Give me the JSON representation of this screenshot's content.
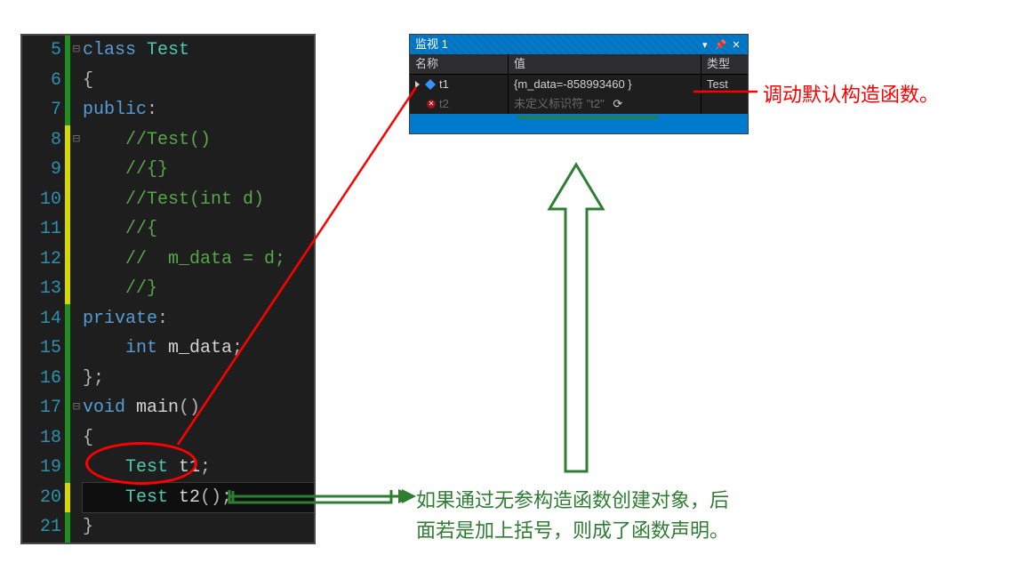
{
  "editor": {
    "lines": [
      {
        "num": 5,
        "marker": "green",
        "fold": "⊟",
        "tokens": [
          {
            "t": "kw",
            "v": "class"
          },
          {
            "t": "plain",
            "v": " "
          },
          {
            "t": "type",
            "v": "Test"
          }
        ]
      },
      {
        "num": 6,
        "marker": "green",
        "fold": " ",
        "tokens": [
          {
            "t": "punct",
            "v": "{"
          }
        ]
      },
      {
        "num": 7,
        "marker": "green",
        "fold": " ",
        "tokens": [
          {
            "t": "kw",
            "v": "public"
          },
          {
            "t": "punct",
            "v": ":"
          }
        ]
      },
      {
        "num": 8,
        "marker": "yellow",
        "fold": "⊟",
        "tokens": [
          {
            "t": "plain",
            "v": "    "
          },
          {
            "t": "comment",
            "v": "//Test()"
          }
        ]
      },
      {
        "num": 9,
        "marker": "yellow",
        "fold": " ",
        "tokens": [
          {
            "t": "plain",
            "v": "    "
          },
          {
            "t": "comment",
            "v": "//{}"
          }
        ]
      },
      {
        "num": 10,
        "marker": "yellow",
        "fold": " ",
        "tokens": [
          {
            "t": "plain",
            "v": "    "
          },
          {
            "t": "comment",
            "v": "//Test(int d)"
          }
        ]
      },
      {
        "num": 11,
        "marker": "yellow",
        "fold": " ",
        "tokens": [
          {
            "t": "plain",
            "v": "    "
          },
          {
            "t": "comment",
            "v": "//{"
          }
        ]
      },
      {
        "num": 12,
        "marker": "yellow",
        "fold": " ",
        "tokens": [
          {
            "t": "plain",
            "v": "    "
          },
          {
            "t": "comment",
            "v": "//  m_data = d;"
          }
        ]
      },
      {
        "num": 13,
        "marker": "yellow",
        "fold": " ",
        "tokens": [
          {
            "t": "plain",
            "v": "    "
          },
          {
            "t": "comment",
            "v": "//}"
          }
        ]
      },
      {
        "num": 14,
        "marker": "green",
        "fold": " ",
        "tokens": [
          {
            "t": "kw",
            "v": "private"
          },
          {
            "t": "punct",
            "v": ":"
          }
        ]
      },
      {
        "num": 15,
        "marker": "green",
        "fold": " ",
        "tokens": [
          {
            "t": "plain",
            "v": "    "
          },
          {
            "t": "kw",
            "v": "int"
          },
          {
            "t": "plain",
            "v": " m_data"
          },
          {
            "t": "punct",
            "v": ";"
          }
        ]
      },
      {
        "num": 16,
        "marker": "green",
        "fold": " ",
        "tokens": [
          {
            "t": "punct",
            "v": "};"
          }
        ]
      },
      {
        "num": 17,
        "marker": "green",
        "fold": "⊟",
        "tokens": [
          {
            "t": "kw",
            "v": "void"
          },
          {
            "t": "plain",
            "v": " main"
          },
          {
            "t": "punct",
            "v": "()"
          }
        ]
      },
      {
        "num": 18,
        "marker": "green",
        "fold": " ",
        "tokens": [
          {
            "t": "punct",
            "v": "{"
          }
        ]
      },
      {
        "num": 19,
        "marker": "green",
        "fold": " ",
        "tokens": [
          {
            "t": "plain",
            "v": "    "
          },
          {
            "t": "type",
            "v": "Test"
          },
          {
            "t": "plain",
            "v": " t1"
          },
          {
            "t": "punct",
            "v": ";"
          }
        ]
      },
      {
        "num": 20,
        "marker": "yellow",
        "fold": " ",
        "current": true,
        "tokens": [
          {
            "t": "plain",
            "v": "    "
          },
          {
            "t": "type",
            "v": "Test"
          },
          {
            "t": "plain",
            "v": " t2"
          },
          {
            "t": "punct",
            "v": "();"
          }
        ]
      },
      {
        "num": 21,
        "marker": "green",
        "fold": " ",
        "tokens": [
          {
            "t": "punct",
            "v": "}"
          }
        ]
      }
    ]
  },
  "watch": {
    "title": "监视 1",
    "columns": {
      "name": "名称",
      "value": "值",
      "type": "类型"
    },
    "rows": [
      {
        "kind": "ok",
        "name": "t1",
        "value": "{m_data=-858993460 }",
        "type": "Test"
      },
      {
        "kind": "err",
        "name": "t2",
        "value": "未定义标识符 \"t2\"",
        "type": ""
      }
    ]
  },
  "annotations": {
    "red": "调动默认构造函数。",
    "green_line1": "如果通过无参构造函数创建对象，后",
    "green_line2": "面若是加上括号，则成了函数声明。"
  }
}
